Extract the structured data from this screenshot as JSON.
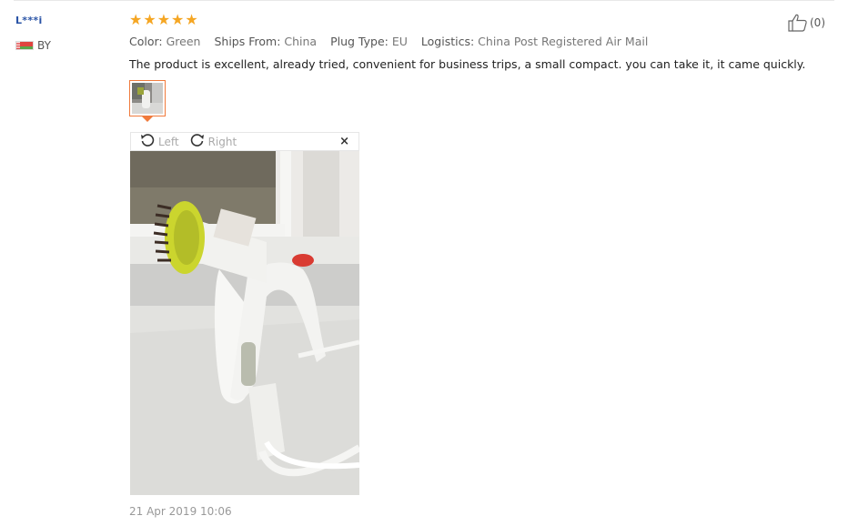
{
  "reviewer": {
    "name": "L***i",
    "country_code": "BY",
    "flag_icon": "belarus-flag-icon"
  },
  "rating": {
    "stars": 5,
    "max": 5,
    "color": "#f5a623"
  },
  "attributes": [
    {
      "key": "Color:",
      "value": "Green"
    },
    {
      "key": "Ships From:",
      "value": "China"
    },
    {
      "key": "Plug Type:",
      "value": "EU"
    },
    {
      "key": "Logistics:",
      "value": "China Post Registered Air Mail"
    }
  ],
  "review_text": "The product is excellent, already tried, convenient for business trips, a small compact. you can take it, it came quickly.",
  "helpful": {
    "icon": "thumbs-up-icon",
    "count": "(0)"
  },
  "viewer": {
    "rotate_left": "Left",
    "rotate_right": "Right",
    "close": "×"
  },
  "date": "21 Apr 2019 10:06",
  "colors": {
    "accent": "#f07a3c",
    "username": "#2953a6"
  }
}
